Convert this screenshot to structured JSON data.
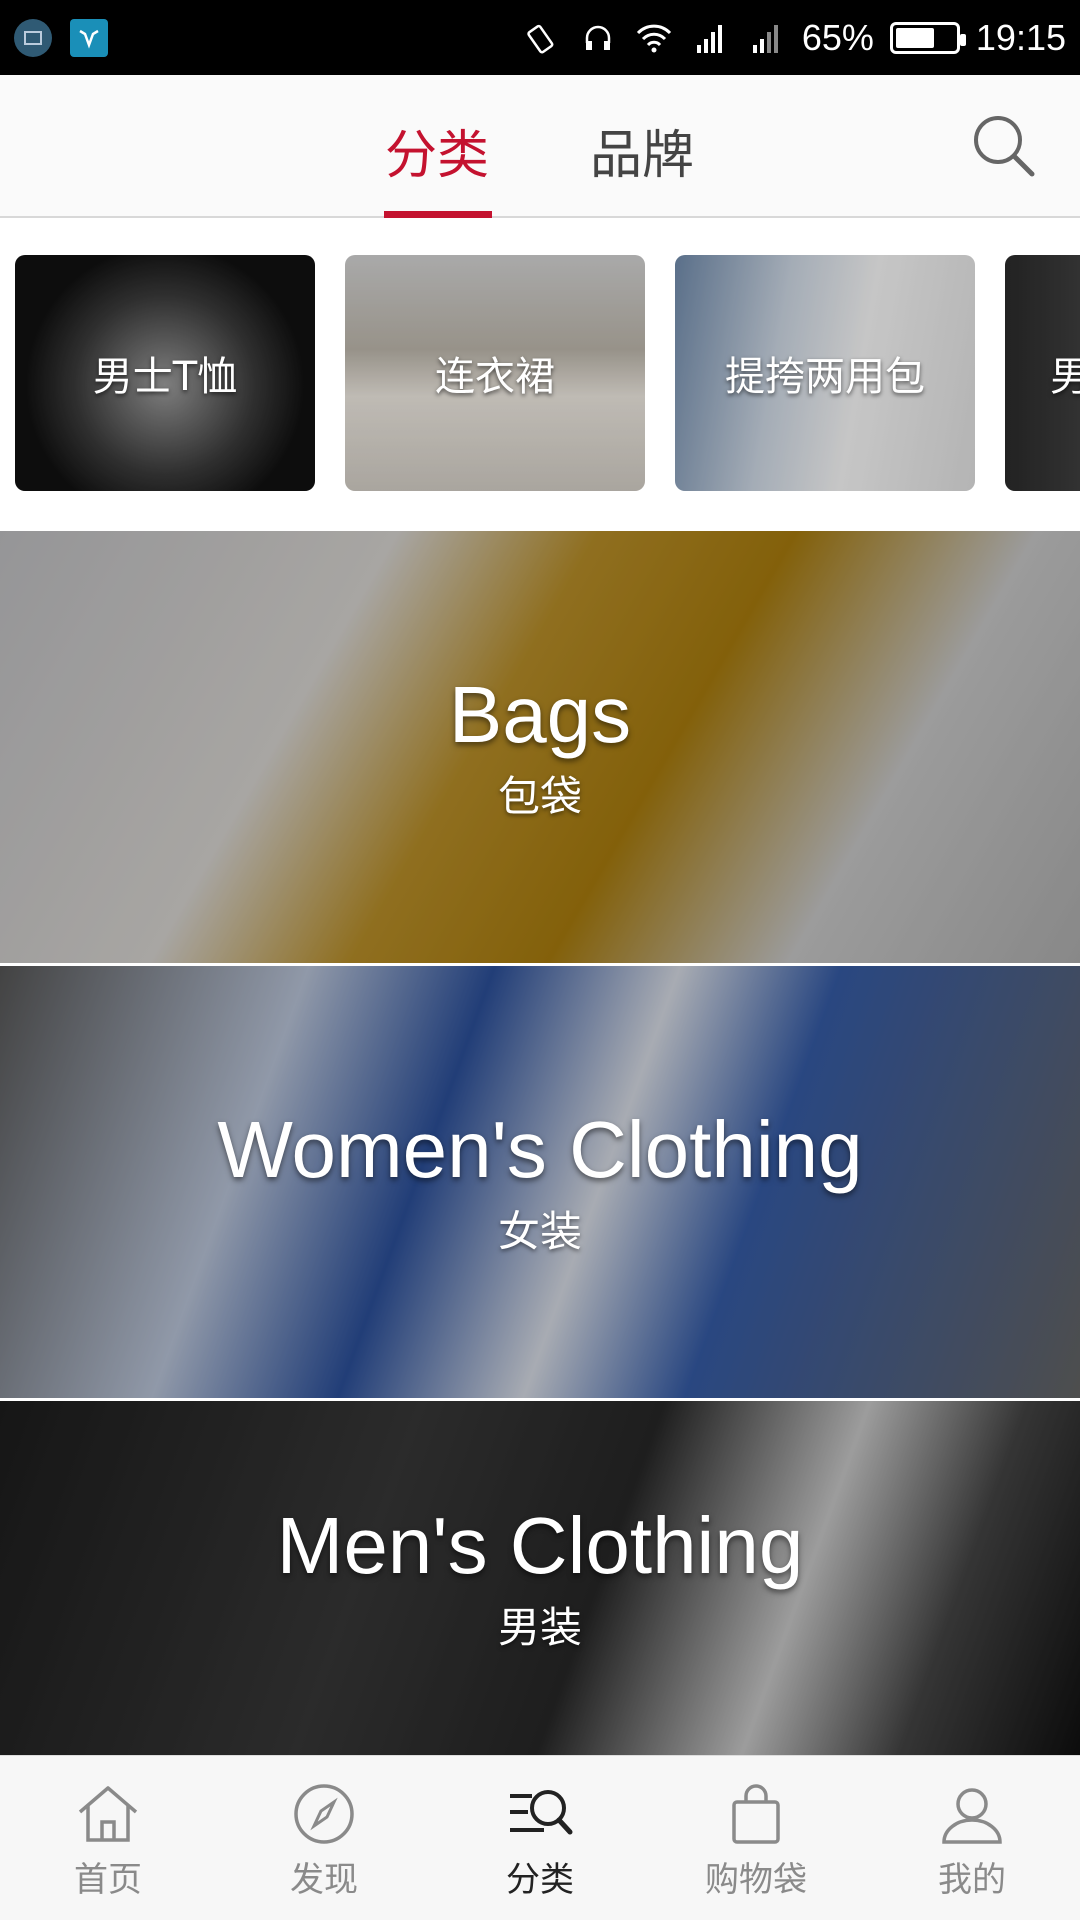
{
  "status_bar": {
    "battery_percent": "65%",
    "time": "19:15"
  },
  "top_nav": {
    "tabs": [
      {
        "label": "分类",
        "active": true
      },
      {
        "label": "品牌",
        "active": false
      }
    ],
    "accent_color": "#c4122f"
  },
  "quick_categories": [
    {
      "label": "男士T恤"
    },
    {
      "label": "连衣裙"
    },
    {
      "label": "提挎两用包"
    },
    {
      "label": "男"
    }
  ],
  "banners": [
    {
      "title": "Bags",
      "subtitle": "包袋"
    },
    {
      "title": "Women's Clothing",
      "subtitle": "女装"
    },
    {
      "title": "Men's Clothing",
      "subtitle": "男装"
    }
  ],
  "bottom_nav": [
    {
      "label": "首页",
      "icon": "home-icon"
    },
    {
      "label": "发现",
      "icon": "compass-icon"
    },
    {
      "label": "分类",
      "icon": "category-search-icon",
      "active": true
    },
    {
      "label": "购物袋",
      "icon": "shopping-bag-icon"
    },
    {
      "label": "我的",
      "icon": "profile-icon"
    }
  ]
}
